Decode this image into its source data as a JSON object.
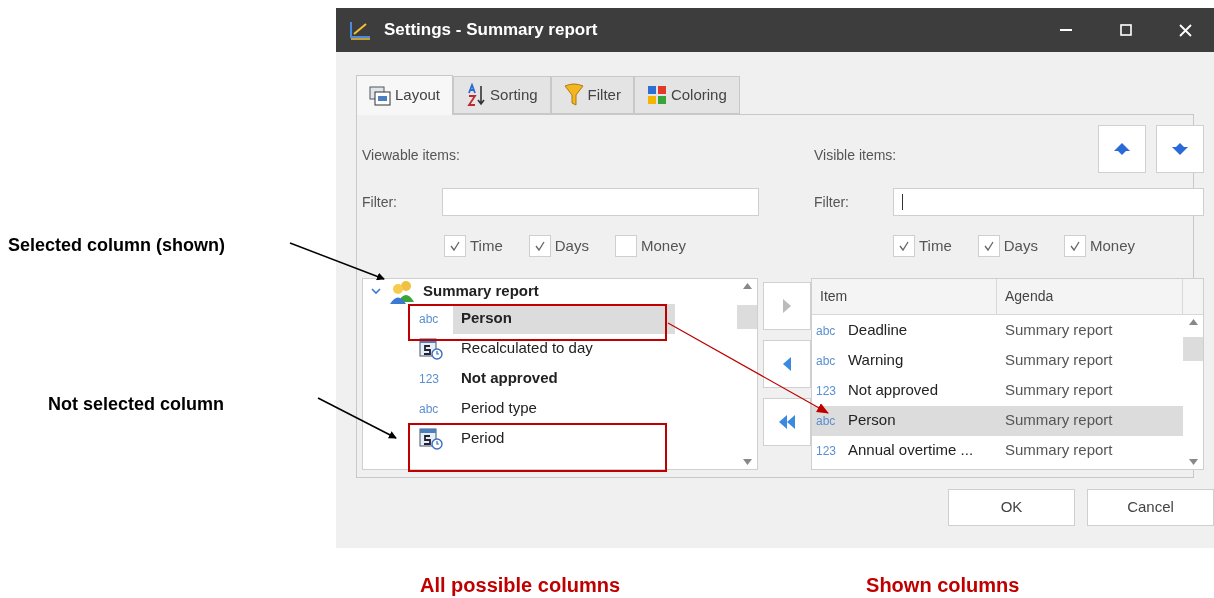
{
  "annotations": [
    {
      "text": "Selected column (shown)"
    },
    {
      "text": "Not selected column"
    }
  ],
  "window": {
    "title": "Settings - Summary report"
  },
  "tabs": [
    {
      "label": "Layout",
      "kind": "layout",
      "selected": true
    },
    {
      "label": "Sorting",
      "kind": "sorting",
      "selected": false
    },
    {
      "label": "Filter",
      "kind": "filter",
      "selected": false
    },
    {
      "label": "Coloring",
      "kind": "coloring",
      "selected": false
    }
  ],
  "viewable": {
    "heading": "Viewable items:",
    "filter_label": "Filter:",
    "checkboxes": [
      {
        "label": "Time",
        "checked": true
      },
      {
        "label": "Days",
        "checked": true
      },
      {
        "label": "Money",
        "checked": false
      }
    ],
    "tree": {
      "label": "Summary report",
      "expanded": true,
      "children": [
        {
          "label": "Person",
          "kind": "text",
          "type_label": "abc",
          "bold": true,
          "selected": true
        },
        {
          "label": "Recalculated to day",
          "kind": "calc",
          "bold": false,
          "selected": false
        },
        {
          "label": "Not approved",
          "kind": "number",
          "type_label": "123",
          "bold": true,
          "selected": false
        },
        {
          "label": "Period type",
          "kind": "text",
          "type_label": "abc",
          "bold": false,
          "selected": false
        },
        {
          "label": "Period",
          "kind": "calc",
          "bold": false,
          "selected": false
        }
      ]
    }
  },
  "visible": {
    "heading": "Visible items:",
    "filter_label": "Filter:",
    "checkboxes": [
      {
        "label": "Time",
        "checked": true
      },
      {
        "label": "Days",
        "checked": true
      },
      {
        "label": "Money",
        "checked": true
      }
    ],
    "table": {
      "columns": [
        "Item",
        "Agenda"
      ],
      "rows": [
        {
          "type_label": "abc",
          "item": "Deadline",
          "agenda": "Summary report",
          "selected": false
        },
        {
          "type_label": "abc",
          "item": "Warning",
          "agenda": "Summary report",
          "selected": false
        },
        {
          "type_label": "123",
          "item": "Not approved",
          "agenda": "Summary report",
          "selected": false
        },
        {
          "type_label": "abc",
          "item": "Person",
          "agenda": "Summary report",
          "selected": true
        },
        {
          "type_label": "123",
          "item": "Annual overtime ...",
          "agenda": "Summary report",
          "selected": false
        }
      ]
    }
  },
  "buttons": [
    "OK",
    "Cancel"
  ],
  "captions": [
    {
      "text": "All possible columns"
    },
    {
      "text": "Shown columns"
    }
  ]
}
